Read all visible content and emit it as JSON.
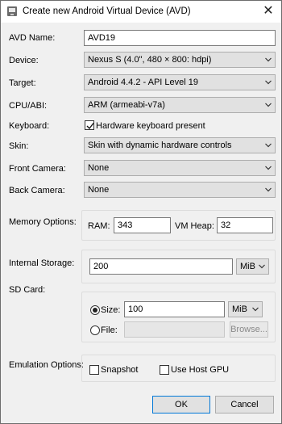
{
  "window": {
    "title": "Create new Android Virtual Device (AVD)",
    "close_symbol": "✕"
  },
  "fields": {
    "avd_name": {
      "label": "AVD Name:",
      "value": "AVD19"
    },
    "device": {
      "label": "Device:",
      "value": "Nexus S (4.0\", 480 × 800: hdpi)"
    },
    "target": {
      "label": "Target:",
      "value": "Android 4.4.2 - API Level 19"
    },
    "cpu_abi": {
      "label": "CPU/ABI:",
      "value": "ARM (armeabi-v7a)"
    },
    "keyboard": {
      "label": "Keyboard:",
      "checkbox_label": "Hardware keyboard present",
      "checked": true
    },
    "skin": {
      "label": "Skin:",
      "value": "Skin with dynamic hardware controls"
    },
    "front_camera": {
      "label": "Front Camera:",
      "value": "None"
    },
    "back_camera": {
      "label": "Back Camera:",
      "value": "None"
    }
  },
  "memory": {
    "label": "Memory Options:",
    "ram_label": "RAM:",
    "ram_value": "343",
    "vm_heap_label": "VM Heap:",
    "vm_heap_value": "32"
  },
  "internal_storage": {
    "label": "Internal Storage:",
    "value": "200",
    "unit": "MiB"
  },
  "sd_card": {
    "label": "SD Card:",
    "size_label": "Size:",
    "size_value": "100",
    "size_unit": "MiB",
    "size_selected": true,
    "file_label": "File:",
    "file_value": "",
    "browse_label": "Browse..."
  },
  "emulation": {
    "label": "Emulation Options:",
    "snapshot_label": "Snapshot",
    "snapshot_checked": false,
    "host_gpu_label": "Use Host GPU",
    "host_gpu_checked": false
  },
  "buttons": {
    "ok": "OK",
    "cancel": "Cancel"
  }
}
